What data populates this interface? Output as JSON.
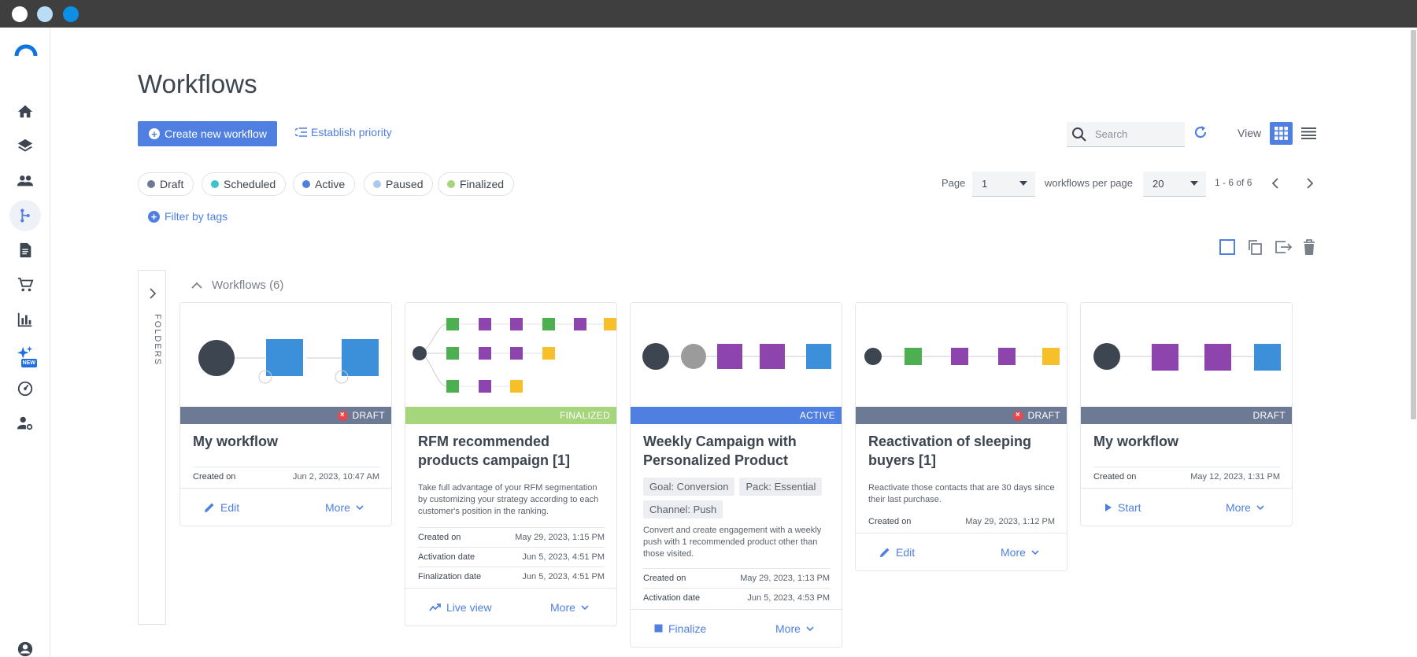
{
  "window": {
    "buttons": [
      "close",
      "minimize",
      "maximize"
    ]
  },
  "sidebar": {
    "items": [
      {
        "icon": "home-icon"
      },
      {
        "icon": "layers-icon"
      },
      {
        "icon": "people-icon"
      },
      {
        "icon": "workflow-icon",
        "active": true
      },
      {
        "icon": "document-icon"
      },
      {
        "icon": "cart-icon"
      },
      {
        "icon": "bar-chart-icon"
      },
      {
        "icon": "sparkles-icon",
        "badge": "NEW"
      },
      {
        "icon": "gauge-icon"
      },
      {
        "icon": "user-settings-icon"
      },
      {
        "icon": "account-icon"
      }
    ]
  },
  "page": {
    "title": "Workflows"
  },
  "toolbar": {
    "create_label": "Create new workflow",
    "priority_label": "Establish priority",
    "search_placeholder": "Search",
    "view_label": "View"
  },
  "status_filters": [
    {
      "label": "Draft",
      "color": "#6d7a96"
    },
    {
      "label": "Scheduled",
      "color": "#3fc1c9"
    },
    {
      "label": "Active",
      "color": "#4f7fe0"
    },
    {
      "label": "Paused",
      "color": "#a9c9f0"
    },
    {
      "label": "Finalized",
      "color": "#a6d67c"
    }
  ],
  "pagination": {
    "page_label": "Page",
    "page_value": "1",
    "per_page_label": "workflows per page",
    "per_page_value": "20",
    "range": "1 - 6 of 6"
  },
  "filter_tags_label": "Filter by tags",
  "folders_label": "FOLDERS",
  "group": {
    "title": "Workflows (6)"
  },
  "cards": [
    {
      "status": "DRAFT",
      "title": "My workflow",
      "meta": [
        {
          "k": "Created on",
          "v": "Jun 2, 2023, 10:47 AM"
        }
      ],
      "action": "Edit",
      "more": "More"
    },
    {
      "status": "FINALIZED",
      "title": "RFM recommended products campaign [1]",
      "description": "Take full advantage of your RFM segmentation by customizing your strategy according to each customer's position in the ranking.",
      "meta": [
        {
          "k": "Created on",
          "v": "May 29, 2023, 1:15 PM"
        },
        {
          "k": "Activation date",
          "v": "Jun 5, 2023, 4:51 PM"
        },
        {
          "k": "Finalization date",
          "v": "Jun 5, 2023, 4:51 PM"
        }
      ],
      "action": "Live view",
      "more": "More"
    },
    {
      "status": "ACTIVE",
      "title": "Weekly Campaign with Personalized Product",
      "tags": [
        "Goal: Conversion",
        "Pack: Essential",
        "Channel: Push"
      ],
      "description": "Convert and create engagement with a weekly push with 1 recommended product other than those visited.",
      "meta": [
        {
          "k": "Created on",
          "v": "May 29, 2023, 1:13 PM"
        },
        {
          "k": "Activation date",
          "v": "Jun 5, 2023, 4:53 PM"
        }
      ],
      "action": "Finalize",
      "more": "More"
    },
    {
      "status": "DRAFT",
      "title": "Reactivation of sleeping buyers [1]",
      "description": "Reactivate those contacts that are 30 days since their last purchase.",
      "meta": [
        {
          "k": "Created on",
          "v": "May 29, 2023, 1:12 PM"
        }
      ],
      "action": "Edit",
      "more": "More"
    },
    {
      "status": "DRAFT",
      "title": "My workflow",
      "meta": [
        {
          "k": "Created on",
          "v": "May 12, 2023, 1:31 PM"
        }
      ],
      "action": "Start",
      "more": "More"
    }
  ]
}
